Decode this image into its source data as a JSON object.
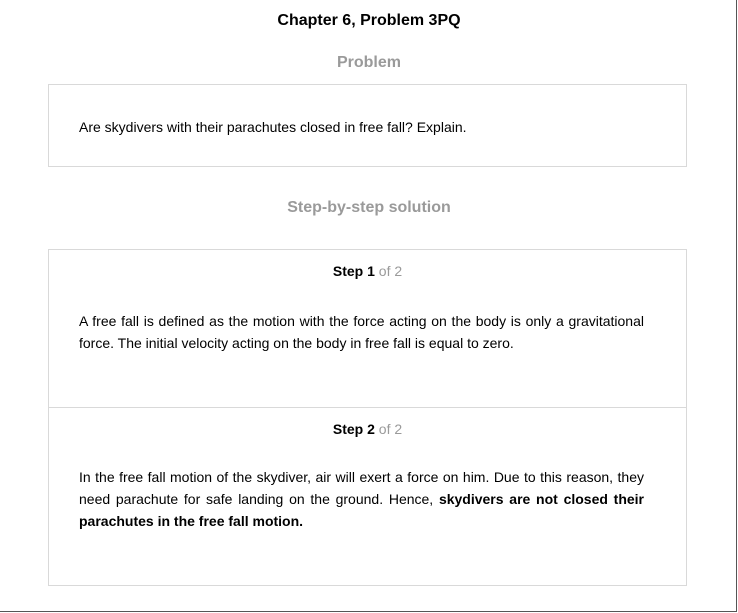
{
  "page": {
    "title": "Chapter 6, Problem 3PQ"
  },
  "problem": {
    "heading": "Problem",
    "text": "Are skydivers with their parachutes closed in free fall? Explain."
  },
  "solution": {
    "heading": "Step-by-step solution",
    "step_word": "Step",
    "steps": [
      {
        "number": "1",
        "of_label": "of 2",
        "text": "A free fall is defined as the motion with the force acting on the body is only a gravitational force. The initial velocity acting on the body in free fall is equal to zero.",
        "bold_text": ""
      },
      {
        "number": "2",
        "of_label": "of 2",
        "text": "In the free fall motion of the skydiver, air will exert a force on him. Due to this reason, they need parachute for safe landing on the ground. Hence, ",
        "bold_text": "skydivers are not closed their parachutes in the free fall motion."
      }
    ]
  }
}
